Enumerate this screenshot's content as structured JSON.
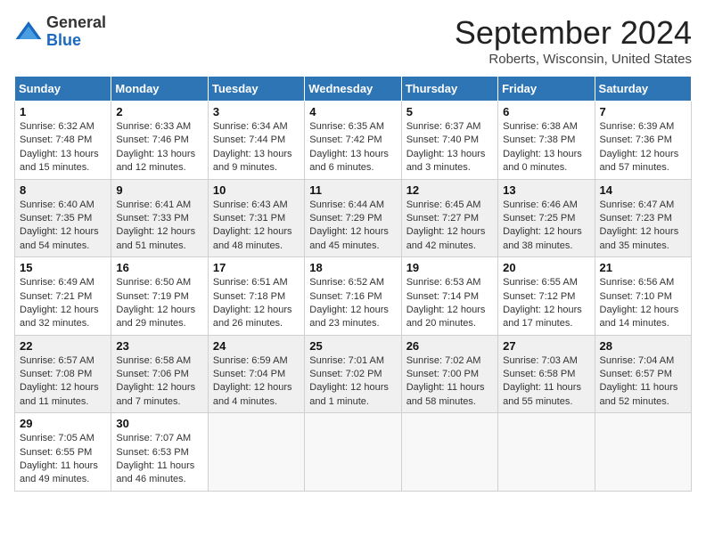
{
  "header": {
    "logo_general": "General",
    "logo_blue": "Blue",
    "month_title": "September 2024",
    "subtitle": "Roberts, Wisconsin, United States"
  },
  "days_of_week": [
    "Sunday",
    "Monday",
    "Tuesday",
    "Wednesday",
    "Thursday",
    "Friday",
    "Saturday"
  ],
  "weeks": [
    [
      {
        "day": 1,
        "info": "Sunrise: 6:32 AM\nSunset: 7:48 PM\nDaylight: 13 hours\nand 15 minutes."
      },
      {
        "day": 2,
        "info": "Sunrise: 6:33 AM\nSunset: 7:46 PM\nDaylight: 13 hours\nand 12 minutes."
      },
      {
        "day": 3,
        "info": "Sunrise: 6:34 AM\nSunset: 7:44 PM\nDaylight: 13 hours\nand 9 minutes."
      },
      {
        "day": 4,
        "info": "Sunrise: 6:35 AM\nSunset: 7:42 PM\nDaylight: 13 hours\nand 6 minutes."
      },
      {
        "day": 5,
        "info": "Sunrise: 6:37 AM\nSunset: 7:40 PM\nDaylight: 13 hours\nand 3 minutes."
      },
      {
        "day": 6,
        "info": "Sunrise: 6:38 AM\nSunset: 7:38 PM\nDaylight: 13 hours\nand 0 minutes."
      },
      {
        "day": 7,
        "info": "Sunrise: 6:39 AM\nSunset: 7:36 PM\nDaylight: 12 hours\nand 57 minutes."
      }
    ],
    [
      {
        "day": 8,
        "info": "Sunrise: 6:40 AM\nSunset: 7:35 PM\nDaylight: 12 hours\nand 54 minutes."
      },
      {
        "day": 9,
        "info": "Sunrise: 6:41 AM\nSunset: 7:33 PM\nDaylight: 12 hours\nand 51 minutes."
      },
      {
        "day": 10,
        "info": "Sunrise: 6:43 AM\nSunset: 7:31 PM\nDaylight: 12 hours\nand 48 minutes."
      },
      {
        "day": 11,
        "info": "Sunrise: 6:44 AM\nSunset: 7:29 PM\nDaylight: 12 hours\nand 45 minutes."
      },
      {
        "day": 12,
        "info": "Sunrise: 6:45 AM\nSunset: 7:27 PM\nDaylight: 12 hours\nand 42 minutes."
      },
      {
        "day": 13,
        "info": "Sunrise: 6:46 AM\nSunset: 7:25 PM\nDaylight: 12 hours\nand 38 minutes."
      },
      {
        "day": 14,
        "info": "Sunrise: 6:47 AM\nSunset: 7:23 PM\nDaylight: 12 hours\nand 35 minutes."
      }
    ],
    [
      {
        "day": 15,
        "info": "Sunrise: 6:49 AM\nSunset: 7:21 PM\nDaylight: 12 hours\nand 32 minutes."
      },
      {
        "day": 16,
        "info": "Sunrise: 6:50 AM\nSunset: 7:19 PM\nDaylight: 12 hours\nand 29 minutes."
      },
      {
        "day": 17,
        "info": "Sunrise: 6:51 AM\nSunset: 7:18 PM\nDaylight: 12 hours\nand 26 minutes."
      },
      {
        "day": 18,
        "info": "Sunrise: 6:52 AM\nSunset: 7:16 PM\nDaylight: 12 hours\nand 23 minutes."
      },
      {
        "day": 19,
        "info": "Sunrise: 6:53 AM\nSunset: 7:14 PM\nDaylight: 12 hours\nand 20 minutes."
      },
      {
        "day": 20,
        "info": "Sunrise: 6:55 AM\nSunset: 7:12 PM\nDaylight: 12 hours\nand 17 minutes."
      },
      {
        "day": 21,
        "info": "Sunrise: 6:56 AM\nSunset: 7:10 PM\nDaylight: 12 hours\nand 14 minutes."
      }
    ],
    [
      {
        "day": 22,
        "info": "Sunrise: 6:57 AM\nSunset: 7:08 PM\nDaylight: 12 hours\nand 11 minutes."
      },
      {
        "day": 23,
        "info": "Sunrise: 6:58 AM\nSunset: 7:06 PM\nDaylight: 12 hours\nand 7 minutes."
      },
      {
        "day": 24,
        "info": "Sunrise: 6:59 AM\nSunset: 7:04 PM\nDaylight: 12 hours\nand 4 minutes."
      },
      {
        "day": 25,
        "info": "Sunrise: 7:01 AM\nSunset: 7:02 PM\nDaylight: 12 hours\nand 1 minute."
      },
      {
        "day": 26,
        "info": "Sunrise: 7:02 AM\nSunset: 7:00 PM\nDaylight: 11 hours\nand 58 minutes."
      },
      {
        "day": 27,
        "info": "Sunrise: 7:03 AM\nSunset: 6:58 PM\nDaylight: 11 hours\nand 55 minutes."
      },
      {
        "day": 28,
        "info": "Sunrise: 7:04 AM\nSunset: 6:57 PM\nDaylight: 11 hours\nand 52 minutes."
      }
    ],
    [
      {
        "day": 29,
        "info": "Sunrise: 7:05 AM\nSunset: 6:55 PM\nDaylight: 11 hours\nand 49 minutes."
      },
      {
        "day": 30,
        "info": "Sunrise: 7:07 AM\nSunset: 6:53 PM\nDaylight: 11 hours\nand 46 minutes."
      },
      null,
      null,
      null,
      null,
      null
    ]
  ]
}
